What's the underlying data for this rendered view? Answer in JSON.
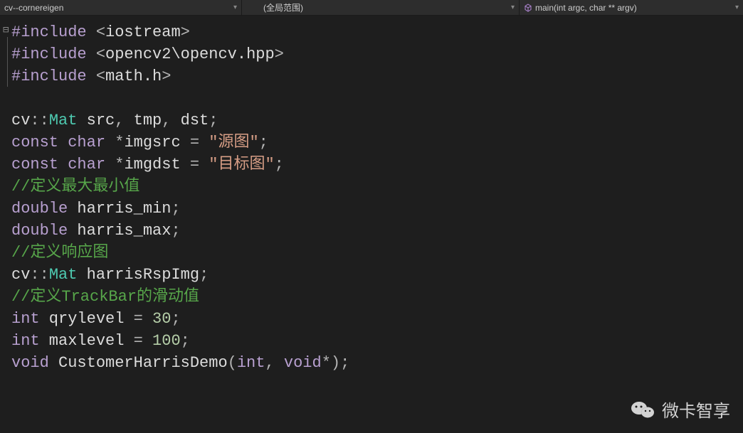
{
  "toolbar": {
    "project_dropdown": "cv--cornereigen",
    "scope_dropdown": "(全局范围)",
    "function_dropdown": "main(int argc, char ** argv)"
  },
  "code": {
    "lines": [
      [
        {
          "t": "kw",
          "v": "#include"
        },
        {
          "t": "ident",
          "v": " "
        },
        {
          "t": "op",
          "v": "<"
        },
        {
          "t": "ident",
          "v": "iostream"
        },
        {
          "t": "op",
          "v": ">"
        }
      ],
      [
        {
          "t": "kw",
          "v": "#include"
        },
        {
          "t": "ident",
          "v": " "
        },
        {
          "t": "op",
          "v": "<"
        },
        {
          "t": "ident",
          "v": "opencv2\\opencv.hpp"
        },
        {
          "t": "op",
          "v": ">"
        }
      ],
      [
        {
          "t": "kw",
          "v": "#include"
        },
        {
          "t": "ident",
          "v": " "
        },
        {
          "t": "op",
          "v": "<"
        },
        {
          "t": "ident",
          "v": "math.h"
        },
        {
          "t": "op",
          "v": ">"
        }
      ],
      [],
      [
        {
          "t": "ident",
          "v": "cv"
        },
        {
          "t": "op",
          "v": "::"
        },
        {
          "t": "type",
          "v": "Mat"
        },
        {
          "t": "ident",
          "v": " src"
        },
        {
          "t": "op",
          "v": ","
        },
        {
          "t": "ident",
          "v": " tmp"
        },
        {
          "t": "op",
          "v": ","
        },
        {
          "t": "ident",
          "v": " dst"
        },
        {
          "t": "op",
          "v": ";"
        }
      ],
      [
        {
          "t": "kw",
          "v": "const"
        },
        {
          "t": "ident",
          "v": " "
        },
        {
          "t": "kw",
          "v": "char"
        },
        {
          "t": "ident",
          "v": " "
        },
        {
          "t": "op",
          "v": "*"
        },
        {
          "t": "ident",
          "v": "imgsrc "
        },
        {
          "t": "op",
          "v": "="
        },
        {
          "t": "ident",
          "v": " "
        },
        {
          "t": "str",
          "v": "\"源图\""
        },
        {
          "t": "op",
          "v": ";"
        }
      ],
      [
        {
          "t": "kw",
          "v": "const"
        },
        {
          "t": "ident",
          "v": " "
        },
        {
          "t": "kw",
          "v": "char"
        },
        {
          "t": "ident",
          "v": " "
        },
        {
          "t": "op",
          "v": "*"
        },
        {
          "t": "ident",
          "v": "imgdst "
        },
        {
          "t": "op",
          "v": "="
        },
        {
          "t": "ident",
          "v": " "
        },
        {
          "t": "str",
          "v": "\"目标图\""
        },
        {
          "t": "op",
          "v": ";"
        }
      ],
      [
        {
          "t": "comment",
          "v": "//定义最大最小值"
        }
      ],
      [
        {
          "t": "kw",
          "v": "double"
        },
        {
          "t": "ident",
          "v": " harris_min"
        },
        {
          "t": "op",
          "v": ";"
        }
      ],
      [
        {
          "t": "kw",
          "v": "double"
        },
        {
          "t": "ident",
          "v": " harris_max"
        },
        {
          "t": "op",
          "v": ";"
        }
      ],
      [
        {
          "t": "comment",
          "v": "//定义响应图"
        }
      ],
      [
        {
          "t": "ident",
          "v": "cv"
        },
        {
          "t": "op",
          "v": "::"
        },
        {
          "t": "type",
          "v": "Mat"
        },
        {
          "t": "ident",
          "v": " harrisRspImg"
        },
        {
          "t": "op",
          "v": ";"
        }
      ],
      [
        {
          "t": "comment",
          "v": "//定义TrackBar的滑动值"
        }
      ],
      [
        {
          "t": "kw",
          "v": "int"
        },
        {
          "t": "ident",
          "v": " qrylevel "
        },
        {
          "t": "op",
          "v": "="
        },
        {
          "t": "ident",
          "v": " "
        },
        {
          "t": "num",
          "v": "30"
        },
        {
          "t": "op",
          "v": ";"
        }
      ],
      [
        {
          "t": "kw",
          "v": "int"
        },
        {
          "t": "ident",
          "v": " maxlevel "
        },
        {
          "t": "op",
          "v": "="
        },
        {
          "t": "ident",
          "v": " "
        },
        {
          "t": "num",
          "v": "100"
        },
        {
          "t": "op",
          "v": ";"
        }
      ],
      [
        {
          "t": "kw",
          "v": "void"
        },
        {
          "t": "ident",
          "v": " CustomerHarrisDemo"
        },
        {
          "t": "op",
          "v": "("
        },
        {
          "t": "kw",
          "v": "int"
        },
        {
          "t": "op",
          "v": ","
        },
        {
          "t": "ident",
          "v": " "
        },
        {
          "t": "kw",
          "v": "void"
        },
        {
          "t": "op",
          "v": "*);"
        }
      ]
    ]
  },
  "watermark": {
    "text": "微卡智享"
  }
}
